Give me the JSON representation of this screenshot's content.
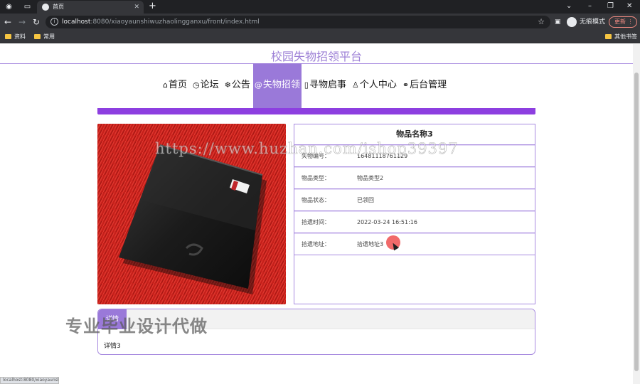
{
  "browser": {
    "tab_title": "首页",
    "new_tab": "+",
    "url_host": "localhost",
    "url_path": ":8080/xiaoyaunshiwuzhaolingganxu/front/index.html",
    "incognito_label": "无痕模式",
    "update_label": "更新",
    "bookmarks": [
      "资料",
      "常用"
    ],
    "other_bookmarks": "其他书签"
  },
  "site": {
    "title": "校园失物招领平台",
    "nav": [
      {
        "icon": "home-icon",
        "glyph": "⌂",
        "label": "首页"
      },
      {
        "icon": "clock-icon",
        "glyph": "◷",
        "label": "论坛"
      },
      {
        "icon": "asterisk-icon",
        "glyph": "❄",
        "label": "公告"
      },
      {
        "icon": "at-icon",
        "glyph": "@",
        "label": "失物招领"
      },
      {
        "icon": "notice-icon",
        "glyph": "▯",
        "label": "寻物启事"
      },
      {
        "icon": "user-icon",
        "glyph": "♙",
        "label": "个人中心"
      },
      {
        "icon": "link-icon",
        "glyph": "⚭",
        "label": "后台管理"
      }
    ],
    "active_nav": "失物招领"
  },
  "item": {
    "name": "物品名称3",
    "fields": [
      {
        "label": "失物编号：",
        "value": "16481118761129"
      },
      {
        "label": "物品类型：",
        "value": "物品类型2"
      },
      {
        "label": "物品状态：",
        "value": "已领回"
      },
      {
        "label": "拾遗时间：",
        "value": "2022-03-24 16:51:16"
      },
      {
        "label": "拾遗地址：",
        "value": "拾遗地址3"
      }
    ],
    "detail_tab": "详情",
    "detail_text": "详情3"
  },
  "overlays": {
    "watermark_url": "https://www.huzhan.com/ishop39397",
    "watermark_cn": "专业毕业设计代做",
    "status_tip": "localhost:8080/xiaoyaunshi..."
  },
  "colors": {
    "accent": "#9a79d9",
    "bar": "#8d3fe0",
    "border": "#a88be0"
  }
}
